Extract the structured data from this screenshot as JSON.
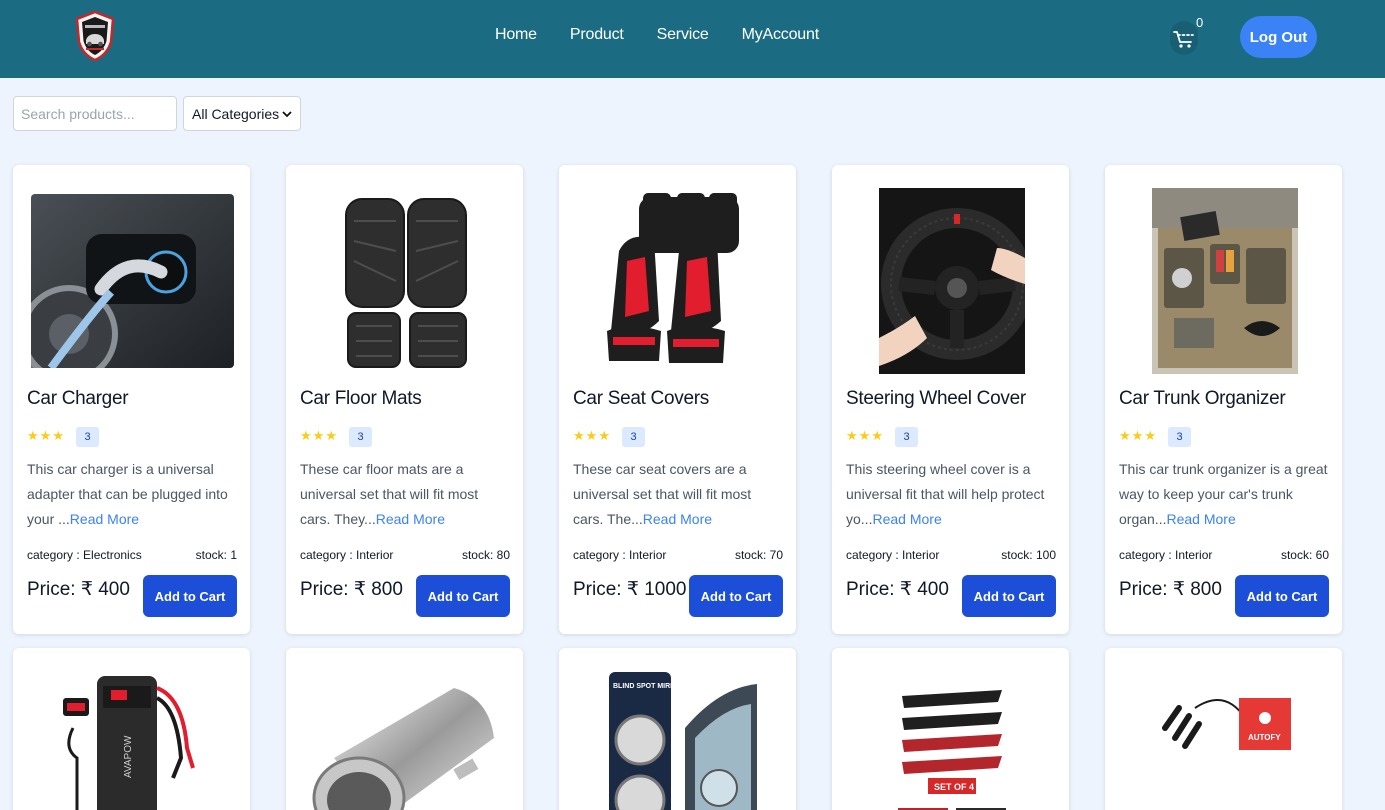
{
  "header": {
    "logo_icon": "car-shield-logo-icon",
    "nav": [
      "Home",
      "Product",
      "Service",
      "MyAccount"
    ],
    "cart_icon": "cart-icon",
    "cart_count": "0",
    "logout_label": "Log Out",
    "colors": {
      "navbar": "#1b6b82",
      "logout": "#3b82f6"
    }
  },
  "filters": {
    "search_placeholder": "Search products...",
    "category_selected": "All Categories"
  },
  "products": [
    {
      "title": "Car Charger",
      "rating": "3",
      "stars": 3,
      "desc": "This car charger is a universal adapter that can be plugged into your ...",
      "read_more": "Read More",
      "category": "category : Electronics",
      "stock": "stock: 1",
      "price": "Price: ₹ 400",
      "add_label": "Add to Cart",
      "image_icon": "ev-charger-image"
    },
    {
      "title": "Car Floor Mats",
      "rating": "3",
      "stars": 3,
      "desc": "These car floor mats are a universal set that will fit most cars. They...",
      "read_more": "Read More",
      "category": "category : Interior",
      "stock": "stock: 80",
      "price": "Price: ₹ 800",
      "add_label": "Add to Cart",
      "image_icon": "floor-mats-image"
    },
    {
      "title": "Car Seat Covers",
      "rating": "3",
      "stars": 3,
      "desc": "These car seat covers are a universal set that will fit most cars. The...",
      "read_more": "Read More",
      "category": "category : Interior",
      "stock": "stock: 70",
      "price": "Price: ₹ 1000",
      "add_label": "Add to Cart",
      "image_icon": "seat-covers-image"
    },
    {
      "title": "Steering Wheel Cover",
      "rating": "3",
      "stars": 3,
      "desc": "This steering wheel cover is a universal fit that will help protect yo...",
      "read_more": "Read More",
      "category": "category : Interior",
      "stock": "stock: 100",
      "price": "Price: ₹ 400",
      "add_label": "Add to Cart",
      "image_icon": "steering-wheel-image"
    },
    {
      "title": "Car Trunk Organizer",
      "rating": "3",
      "stars": 3,
      "desc": "This car trunk organizer is a great way to keep your car's trunk organ...",
      "read_more": "Read More",
      "category": "category : Interior",
      "stock": "stock: 60",
      "price": "Price: ₹ 800",
      "add_label": "Add to Cart",
      "image_icon": "trunk-organizer-image"
    }
  ],
  "products_row2": [
    {
      "image_icon": "jump-starter-image",
      "image_text": "AVAPOW"
    },
    {
      "image_icon": "exhaust-tip-image"
    },
    {
      "image_icon": "blind-spot-mirror-image",
      "image_text": "BLIND SPOT MIRROR"
    },
    {
      "image_icon": "door-guard-strips-image",
      "image_text": "SET OF 4"
    },
    {
      "image_icon": "ambient-light-kit-image",
      "image_text": "AUTOFY"
    }
  ]
}
